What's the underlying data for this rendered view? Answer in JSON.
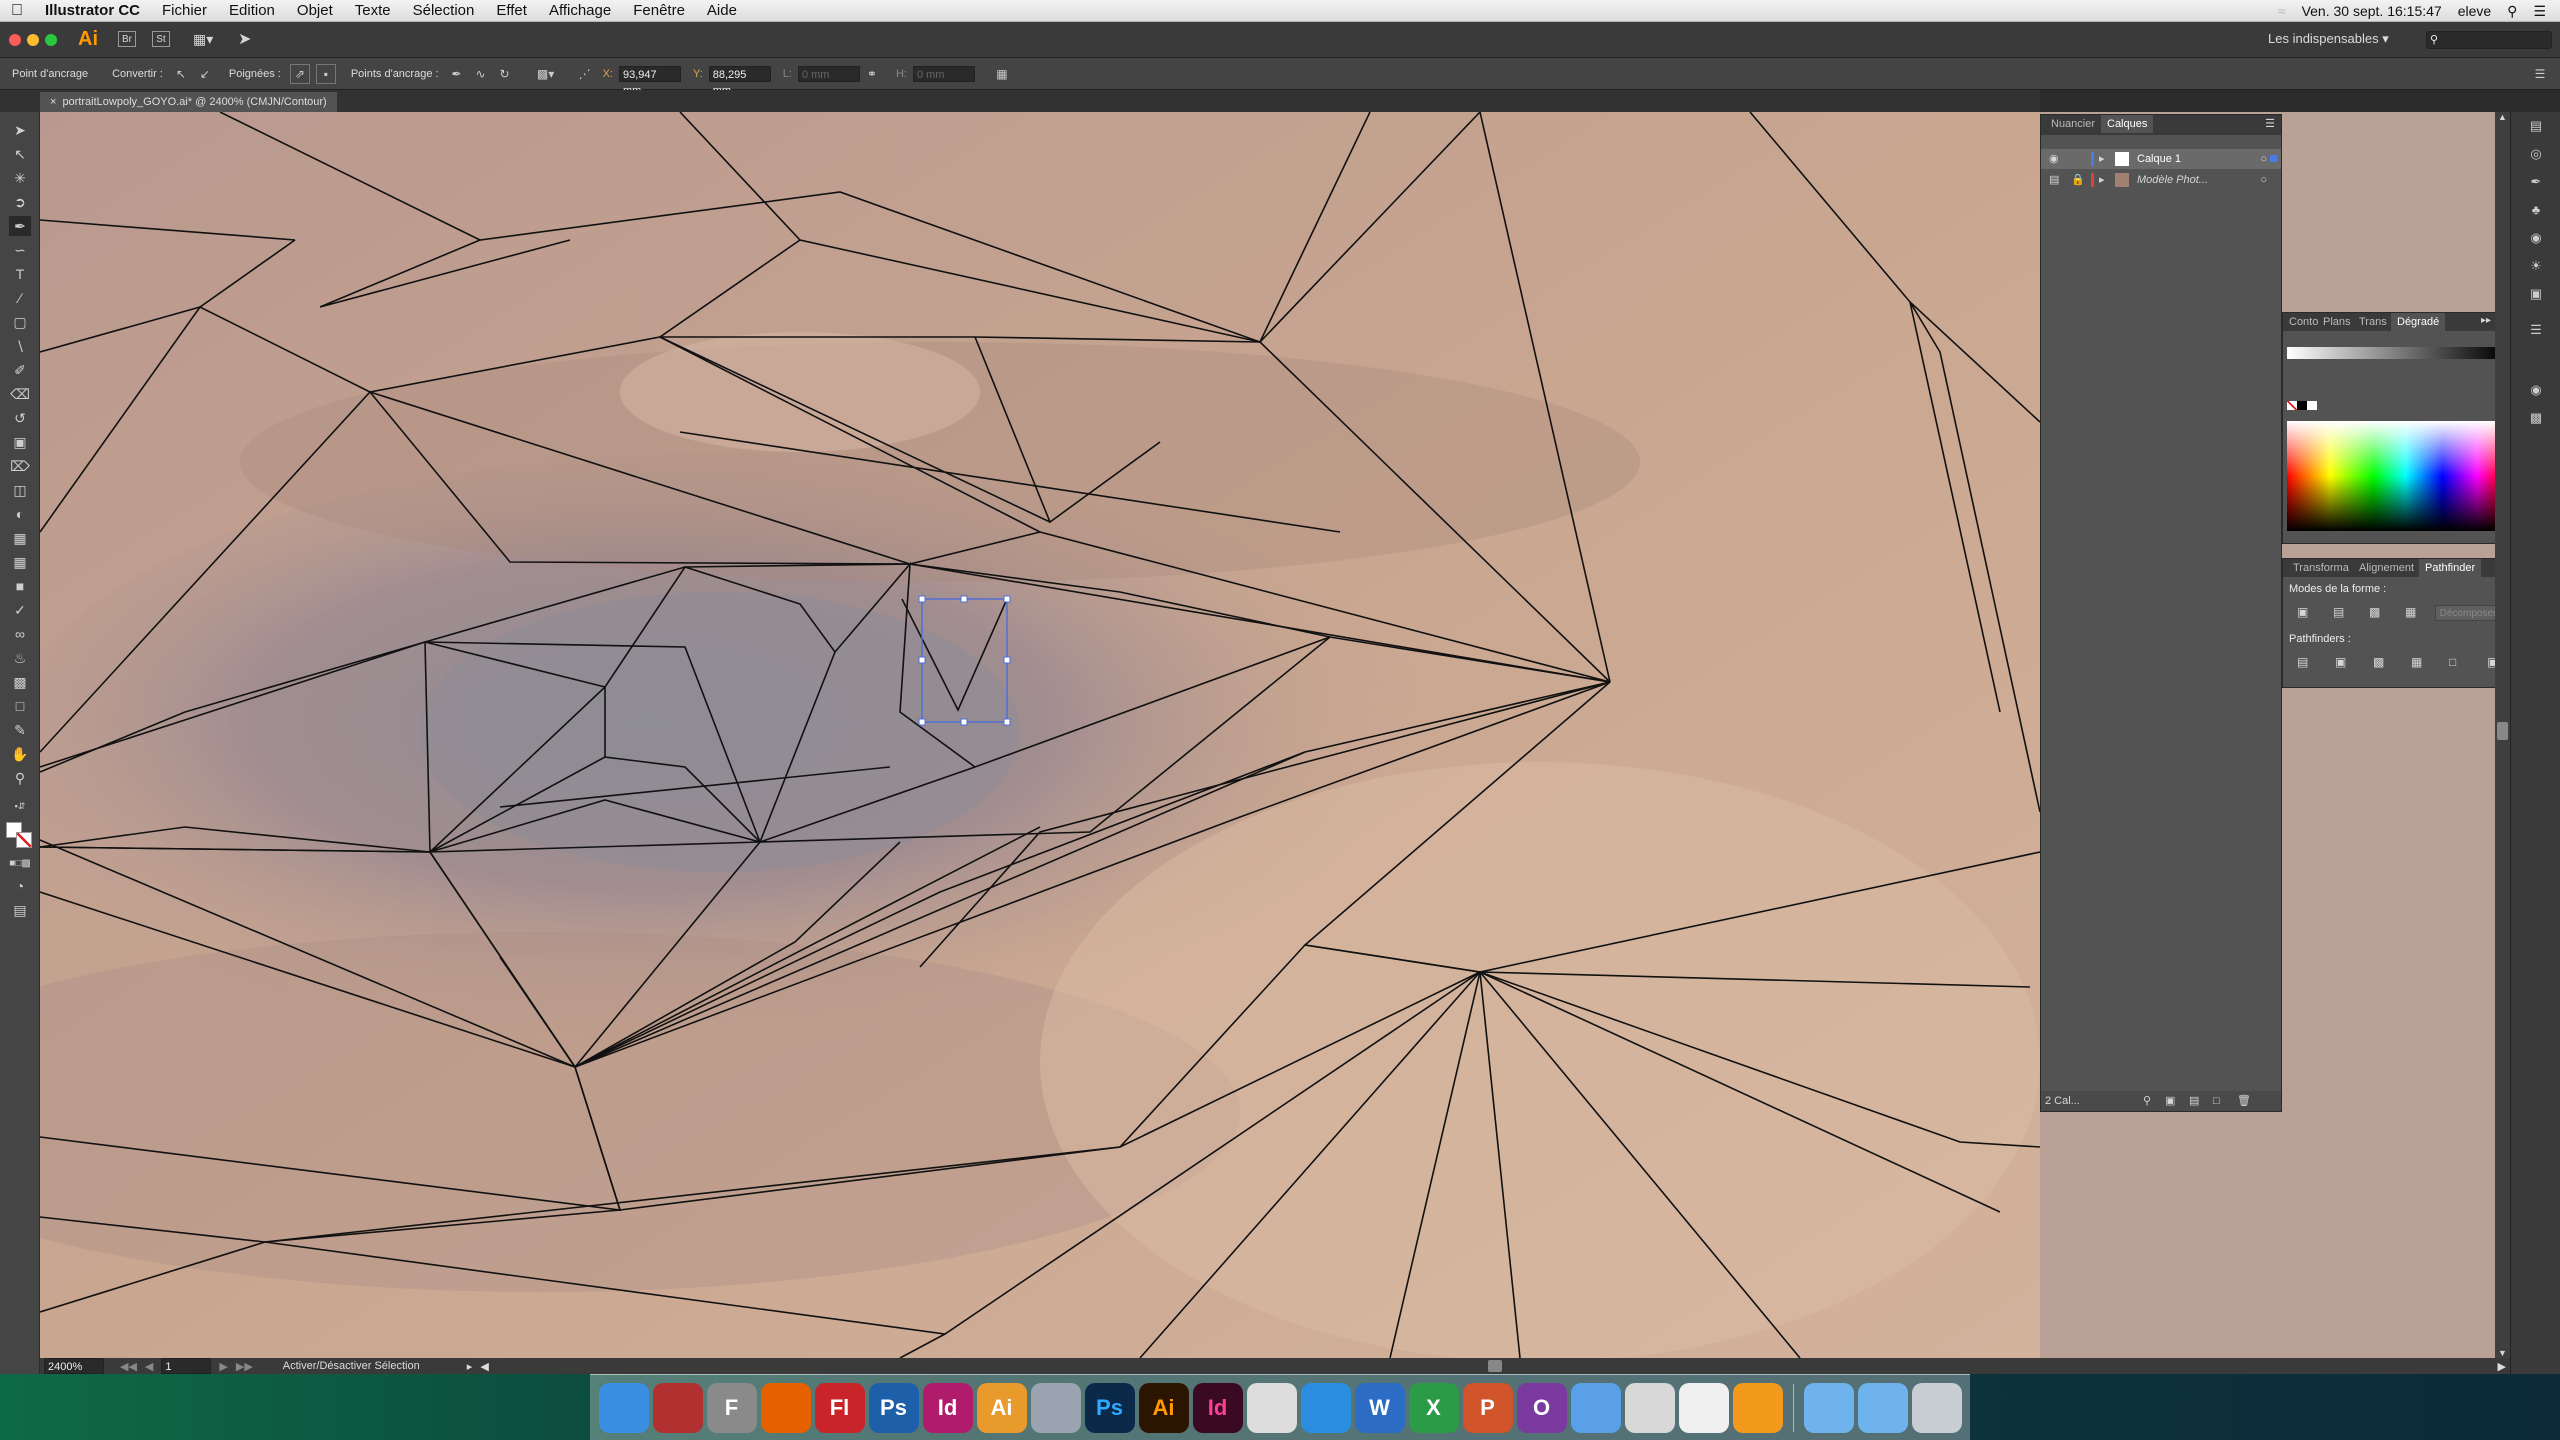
{
  "menubar": {
    "app_name": "Illustrator CC",
    "items": [
      "Fichier",
      "Edition",
      "Objet",
      "Texte",
      "Sélection",
      "Effet",
      "Affichage",
      "Fenêtre",
      "Aide"
    ],
    "datetime": "Ven. 30 sept.  16:15:47",
    "user": "eleve"
  },
  "appbar": {
    "logo": "Ai",
    "bridge": "Br",
    "stock": "St",
    "workspace": "Les indispensables",
    "search_placeholder": ""
  },
  "controlbar": {
    "anchor_label": "Point d'ancrage",
    "convert_label": "Convertir :",
    "handles_label": "Poignées :",
    "anchors_label": "Points d'ancrage :",
    "x_label": "X:",
    "x_value": "93,947 mm",
    "y_label": "Y:",
    "y_value": "88,295 mm",
    "w_label": "L:",
    "w_value": "0 mm",
    "h_label": "H:",
    "h_value": "0 mm"
  },
  "document": {
    "tab_title": "portraitLowpoly_GOYO.ai* @ 2400% (CMJN/Contour)"
  },
  "status": {
    "zoom": "2400%",
    "artboard": "1",
    "action": "Activer/Désactiver Sélection"
  },
  "layers_panel": {
    "tabs": [
      "Nuancier",
      "Calques"
    ],
    "active_tab": "Calques",
    "layers": [
      {
        "name": "Calque 1",
        "selected": true
      },
      {
        "name": "Modèle Phot...",
        "selected": false
      }
    ],
    "footer_count": "2 Cal..."
  },
  "color_panel": {
    "tabs": [
      "Conto",
      "Plans",
      "Trans",
      "Dégradé"
    ],
    "active_tab": "Dégradé"
  },
  "pathfinder_panel": {
    "tabs": [
      "Transforma",
      "Alignement",
      "Pathfinder"
    ],
    "active_tab": "Pathfinder",
    "shape_modes_label": "Modes de la forme :",
    "expand_label": "Décomposer",
    "pathfinders_label": "Pathfinders :"
  },
  "dock": {
    "apps": [
      {
        "name": "finder-icon",
        "label": "",
        "color": "#3b8fe3"
      },
      {
        "name": "photo-booth-icon",
        "label": "",
        "color": "#b33030"
      },
      {
        "name": "font-book-icon",
        "label": "F",
        "color": "#8a8a8a"
      },
      {
        "name": "firefox-icon",
        "label": "",
        "color": "#e66000"
      },
      {
        "name": "flash-icon",
        "label": "Fl",
        "color": "#c8242a"
      },
      {
        "name": "photoshop-cs-icon",
        "label": "Ps",
        "color": "#1d5fa8"
      },
      {
        "name": "indesign-cs-icon",
        "label": "Id",
        "color": "#b01b6b"
      },
      {
        "name": "acrobat-icon",
        "label": "Ai",
        "color": "#e89b2c"
      },
      {
        "name": "scanner-icon",
        "label": "",
        "color": "#9aa4b0"
      },
      {
        "name": "photoshop-icon",
        "label": "Ps",
        "color": "#0b2a4a"
      },
      {
        "name": "illustrator-icon",
        "label": "Ai",
        "color": "#2b1400"
      },
      {
        "name": "indesign-icon",
        "label": "Id",
        "color": "#3a0a23"
      },
      {
        "name": "script-editor-icon",
        "label": "",
        "color": "#dcdcdc"
      },
      {
        "name": "safari-icon",
        "label": "",
        "color": "#2a8de0"
      },
      {
        "name": "word-icon",
        "label": "W",
        "color": "#2c6cc4"
      },
      {
        "name": "excel-icon",
        "label": "X",
        "color": "#2c9b47"
      },
      {
        "name": "powerpoint-icon",
        "label": "P",
        "color": "#d1542a"
      },
      {
        "name": "onenote-icon",
        "label": "O",
        "color": "#7b3aa0"
      },
      {
        "name": "app-store-icon",
        "label": "",
        "color": "#5aa0e8"
      },
      {
        "name": "preview-icon",
        "label": "",
        "color": "#d8d8d8"
      },
      {
        "name": "photos-icon",
        "label": "",
        "color": "#f0f0f0"
      },
      {
        "name": "ibooks-icon",
        "label": "",
        "color": "#f39a1c"
      },
      {
        "name": "applications-folder-icon",
        "label": "",
        "color": "#6fb3ec"
      },
      {
        "name": "documents-folder-icon",
        "label": "",
        "color": "#6fb3ec"
      },
      {
        "name": "trash-icon",
        "label": "",
        "color": "#c9ced4"
      }
    ]
  },
  "colors": {
    "accent_selection": "#4d6ed8",
    "canvas_skin": "#c7a48f"
  }
}
